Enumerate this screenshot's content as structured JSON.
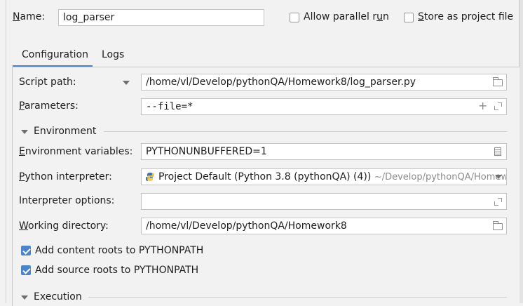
{
  "header": {
    "name_label": "Name:",
    "name_value": "log_parser",
    "allow_parallel_label": "Allow parallel run",
    "allow_parallel_checked": false,
    "store_project_label": "Store as project file",
    "store_project_checked": false
  },
  "tabs": [
    {
      "label": "Configuration",
      "active": true
    },
    {
      "label": "Logs",
      "active": false
    }
  ],
  "config": {
    "script_path_label": "Script path:",
    "script_path_value": "/home/vl/Develop/pythonQA/Homework8/log_parser.py",
    "parameters_label": "Parameters:",
    "parameters_value": "--file=*",
    "environment_section": "Environment",
    "env_vars_label": "Environment variables:",
    "env_vars_value": "PYTHONUNBUFFERED=1",
    "interpreter_label": "Python interpreter:",
    "interpreter_value": "Project Default (Python 3.8 (pythonQA) (4))",
    "interpreter_path": "~/Develop/pythonQA/Homew",
    "interpreter_options_label": "Interpreter options:",
    "interpreter_options_value": "",
    "working_dir_label": "Working directory:",
    "working_dir_value": "/home/vl/Develop/pythonQA/Homework8",
    "add_content_roots_label": "Add content roots to PYTHONPATH",
    "add_content_roots_checked": true,
    "add_source_roots_label": "Add source roots to PYTHONPATH",
    "add_source_roots_checked": true,
    "execution_section": "Execution"
  },
  "colors": {
    "accent": "#4a86c7",
    "background": "#f2f2f2",
    "field_border": "#c4c4c4"
  },
  "icons": {
    "script_path": "chevron-down-icon",
    "browse": "folder-icon",
    "expand": "expand-icon",
    "add": "plus-icon",
    "env_edit": "document-icon",
    "python": "python-icon"
  }
}
